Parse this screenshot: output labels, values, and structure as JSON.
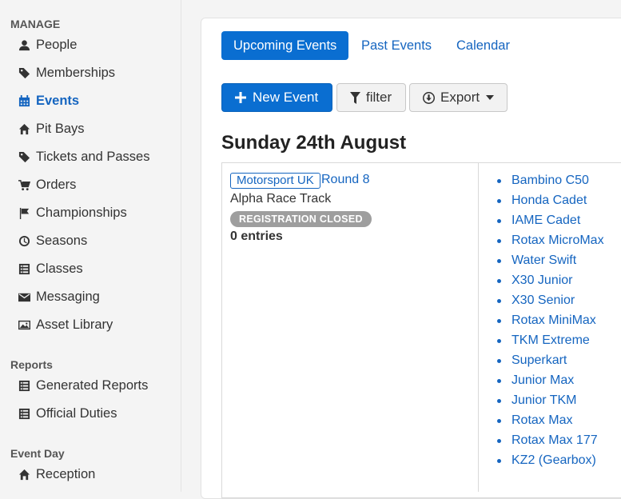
{
  "sidebar": {
    "manage_title": "MANAGE",
    "manage_items": [
      {
        "label": "People",
        "icon": "user-icon"
      },
      {
        "label": "Memberships",
        "icon": "tag-icon"
      },
      {
        "label": "Events",
        "icon": "calendar-icon",
        "active": true
      },
      {
        "label": "Pit Bays",
        "icon": "home-icon"
      },
      {
        "label": "Tickets and Passes",
        "icon": "tag-icon"
      },
      {
        "label": "Orders",
        "icon": "cart-icon"
      },
      {
        "label": "Championships",
        "icon": "flag-icon"
      },
      {
        "label": "Seasons",
        "icon": "clock-icon"
      },
      {
        "label": "Classes",
        "icon": "list-icon"
      },
      {
        "label": "Messaging",
        "icon": "envelope-icon"
      },
      {
        "label": "Asset Library",
        "icon": "image-icon"
      }
    ],
    "reports_title": "Reports",
    "reports_items": [
      {
        "label": "Generated Reports",
        "icon": "list-icon"
      },
      {
        "label": "Official Duties",
        "icon": "list-icon"
      }
    ],
    "eventday_title": "Event Day",
    "eventday_items": [
      {
        "label": "Reception",
        "icon": "home-icon"
      }
    ]
  },
  "tabs": [
    "Upcoming Events",
    "Past Events",
    "Calendar"
  ],
  "toolbar": {
    "new_event": "New Event",
    "filter": "filter",
    "export": "Export"
  },
  "date_heading": "Sunday 24th August",
  "event": {
    "organiser": "Motorsport UK",
    "round": "Round 8",
    "venue": "Alpha Race Track",
    "status": "REGISTRATION CLOSED",
    "entries": "0 entries",
    "classes": [
      "Bambino C50",
      "Honda Cadet",
      "IAME Cadet",
      "Rotax MicroMax",
      "Water Swift",
      "X30 Junior",
      "X30 Senior",
      "Rotax MiniMax",
      "TKM Extreme",
      "Superkart",
      "Junior Max",
      "Junior TKM",
      "Rotax Max",
      "Rotax Max 177",
      "KZ2 (Gearbox)"
    ]
  },
  "colors": {
    "accent": "#0a6ed1",
    "link": "#1565c0",
    "badge": "#9e9e9e"
  }
}
